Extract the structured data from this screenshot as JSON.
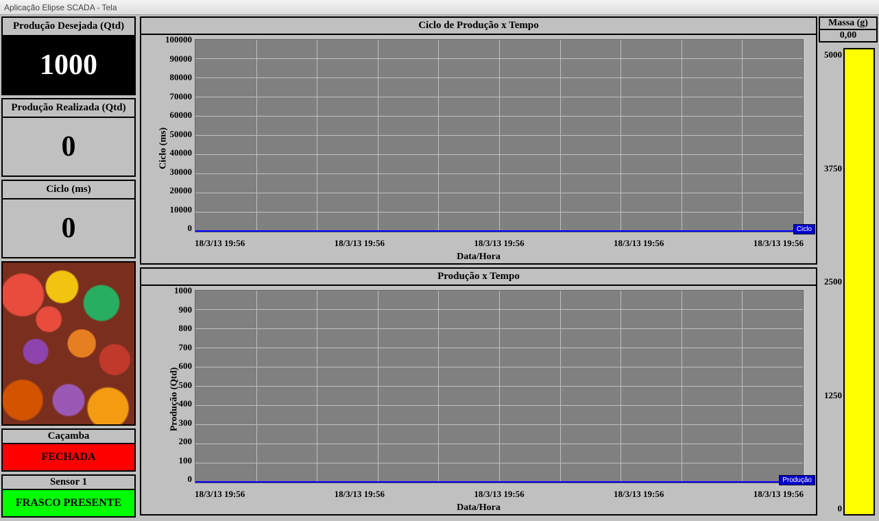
{
  "window": {
    "title": "Aplicação Elipse SCADA - Tela"
  },
  "left": {
    "desired": {
      "label": "Produção Desejada (Qtd)",
      "value": "1000"
    },
    "realized": {
      "label": "Produção Realizada (Qtd)",
      "value": "0"
    },
    "cycle": {
      "label": "Ciclo (ms)",
      "value": "0"
    },
    "cacamba": {
      "label": "Caçamba",
      "value": "FECHADA"
    },
    "sensor1": {
      "label": "Sensor 1",
      "value": "FRASCO PRESENTE"
    }
  },
  "charts": {
    "top": {
      "title": "Ciclo de Produção x Tempo",
      "ylabel": "Ciclo (ms)",
      "xlabel": "Data/Hora",
      "series_tag": "Ciclo",
      "yticks": [
        "0",
        "10000",
        "20000",
        "30000",
        "40000",
        "50000",
        "60000",
        "70000",
        "80000",
        "90000",
        "100000"
      ],
      "xticks": [
        "18/3/13 19:56",
        "18/3/13 19:56",
        "18/3/13 19:56",
        "18/3/13 19:56",
        "18/3/13 19:56"
      ]
    },
    "bottom": {
      "title": "Produção x Tempo",
      "ylabel": "Produção (Qtd)",
      "xlabel": "Data/Hora",
      "series_tag": "Produção",
      "yticks": [
        "0",
        "100",
        "200",
        "300",
        "400",
        "500",
        "600",
        "700",
        "800",
        "900",
        "1000"
      ],
      "xticks": [
        "18/3/13 19:56",
        "18/3/13 19:56",
        "18/3/13 19:56",
        "18/3/13 19:56",
        "18/3/13 19:56"
      ]
    }
  },
  "right": {
    "massa": {
      "label": "Massa (g)",
      "value": "0,00"
    },
    "gauge_ticks": [
      "5000",
      "3750",
      "2500",
      "1250",
      "0"
    ]
  },
  "chart_data": [
    {
      "type": "line",
      "title": "Ciclo de Produção x Tempo",
      "xlabel": "Data/Hora",
      "ylabel": "Ciclo (ms)",
      "ylim": [
        0,
        100000
      ],
      "categories": [
        "18/3/13 19:56",
        "18/3/13 19:56",
        "18/3/13 19:56",
        "18/3/13 19:56",
        "18/3/13 19:56"
      ],
      "series": [
        {
          "name": "Ciclo",
          "values": [
            0,
            0,
            0,
            0,
            0
          ]
        }
      ]
    },
    {
      "type": "line",
      "title": "Produção x Tempo",
      "xlabel": "Data/Hora",
      "ylabel": "Produção (Qtd)",
      "ylim": [
        0,
        1000
      ],
      "categories": [
        "18/3/13 19:56",
        "18/3/13 19:56",
        "18/3/13 19:56",
        "18/3/13 19:56",
        "18/3/13 19:56"
      ],
      "series": [
        {
          "name": "Produção",
          "values": [
            0,
            0,
            0,
            0,
            0
          ]
        }
      ]
    }
  ]
}
